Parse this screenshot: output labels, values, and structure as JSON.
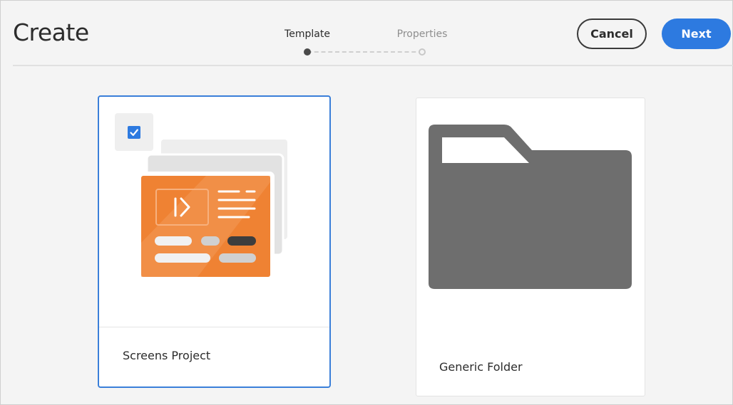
{
  "header": {
    "title": "Create",
    "steps": [
      {
        "label": "Template",
        "state": "current"
      },
      {
        "label": "Properties",
        "state": "upcoming"
      }
    ],
    "cancel_label": "Cancel",
    "next_label": "Next"
  },
  "templates": [
    {
      "label": "Screens Project",
      "selected": true,
      "icon": "screens-project-thumbnail"
    },
    {
      "label": "Generic Folder",
      "selected": false,
      "icon": "folder-icon"
    }
  ],
  "colors": {
    "accent": "#2d7ae0",
    "selected_border": "#3a7fd9",
    "thumbnail_orange": "#ef8233",
    "folder_gray": "#6e6e6e"
  }
}
